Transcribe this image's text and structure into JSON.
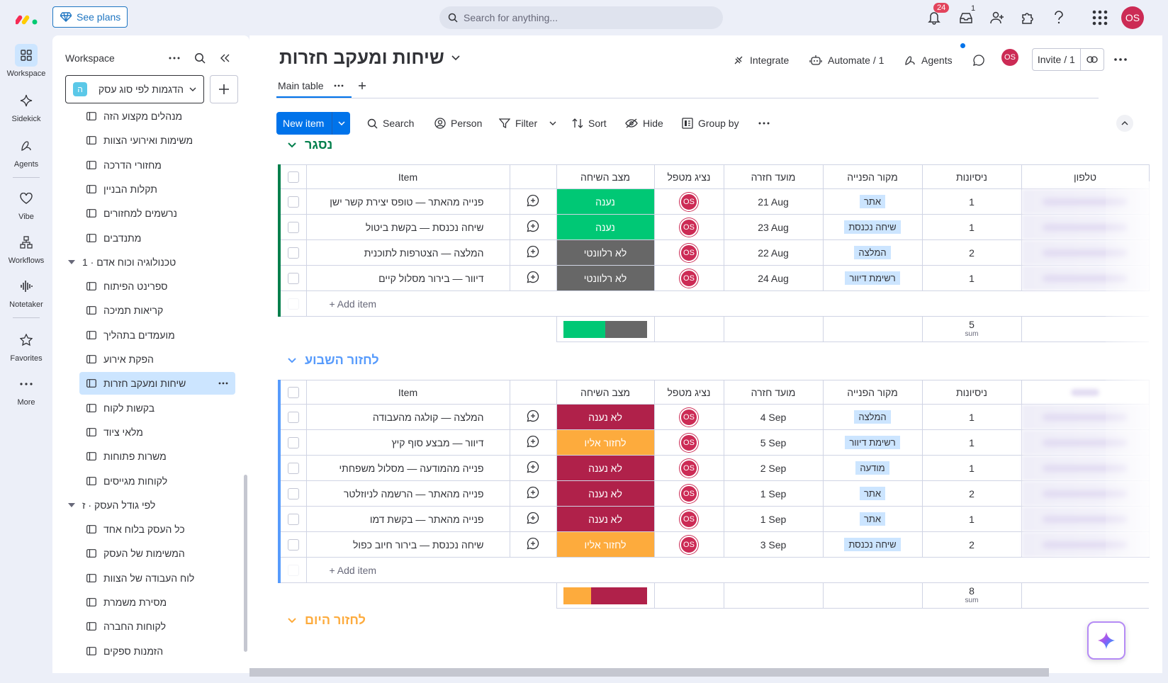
{
  "topbar": {
    "see_plans_label": "See plans",
    "search_placeholder": "Search for anything...",
    "notifications_count": "24",
    "inbox_count": "1",
    "avatar_initials": "OS"
  },
  "rail": {
    "items": [
      {
        "label": "Workspace",
        "icon": "grid-icon"
      },
      {
        "label": "Sidekick",
        "icon": "sparkle-icon"
      },
      {
        "label": "Agents",
        "icon": "agent-icon"
      },
      {
        "label": "Vibe",
        "icon": "heart-icon"
      },
      {
        "label": "Workflows",
        "icon": "workflow-icon"
      },
      {
        "label": "Notetaker",
        "icon": "waveform-icon"
      },
      {
        "label": "Favorites",
        "icon": "star-icon"
      },
      {
        "label": "More",
        "icon": "more-icon"
      }
    ]
  },
  "workspace": {
    "title": "Workspace",
    "selected_workspace": "הדגמות לפי סוג עסק",
    "workspace_letter": "ה",
    "tree": [
      {
        "type": "board",
        "label": "מנהלים מקצוע הזה"
      },
      {
        "type": "board",
        "label": "משימות ואירועי הצוות"
      },
      {
        "type": "board",
        "label": "מחזורי הדרכה"
      },
      {
        "type": "board",
        "label": "תקלות הבניין"
      },
      {
        "type": "board",
        "label": "נרשמים למחזורים"
      },
      {
        "type": "board",
        "label": "מתנדבים"
      },
      {
        "type": "folder",
        "label": "טכנולוגיה וכוח אדם · 1"
      },
      {
        "type": "board",
        "label": "ספרינט הפיתוח"
      },
      {
        "type": "board",
        "label": "קריאות תמיכה"
      },
      {
        "type": "board",
        "label": "מועמדים בתהליך"
      },
      {
        "type": "board",
        "label": "הפקת אירוע"
      },
      {
        "type": "board",
        "label": "שיחות ומעקב חזרות",
        "selected": true
      },
      {
        "type": "board",
        "label": "בקשות לקוח"
      },
      {
        "type": "board",
        "label": "מלאי ציוד"
      },
      {
        "type": "board",
        "label": "משרות פתוחות"
      },
      {
        "type": "board",
        "label": "לקוחות מגייסים"
      },
      {
        "type": "folder",
        "label": "לפי גודל העסק · ז"
      },
      {
        "type": "board",
        "label": "כל העסק בלוח אחד"
      },
      {
        "type": "board",
        "label": "המשימות של העסק"
      },
      {
        "type": "board",
        "label": "לוח העבודה של הצוות"
      },
      {
        "type": "board",
        "label": "מסירת משמרת"
      },
      {
        "type": "board",
        "label": "לקוחות החברה"
      },
      {
        "type": "board",
        "label": "הזמנות ספקים"
      }
    ]
  },
  "board": {
    "title": "שיחות ומעקב חזרות",
    "integrate_label": "Integrate",
    "automate_label": "Automate / 1",
    "agents_label": "Agents",
    "avatar_initials": "OS",
    "invite_label": "Invite / 1",
    "tab_label": "Main table",
    "new_item_label": "New item",
    "toolbar": {
      "search": "Search",
      "person": "Person",
      "filter": "Filter",
      "sort": "Sort",
      "hide": "Hide",
      "group_by": "Group by"
    },
    "columns": {
      "item": "Item",
      "status": "מצב השיחה",
      "owner": "נציג מטפל",
      "date": "מועד חזרה",
      "source": "מקור הפנייה",
      "attempts": "ניסיונות",
      "phone": "טלפון"
    },
    "add_item_label": "+ Add item",
    "sum_label": "sum",
    "status_colors": {
      "נענה": "#00c875",
      "לא רלוונטי": "#676767",
      "לא נענה": "#b0214a",
      "לחזור אליו": "#fdab3d"
    },
    "groups": [
      {
        "name": "נסגר",
        "color": "#037f4c",
        "sum": "5",
        "status_summary": [
          {
            "color": "#00c875",
            "fraction": 0.5
          },
          {
            "color": "#676767",
            "fraction": 0.5
          }
        ],
        "rows": [
          {
            "item": "פנייה מהאתר — טופס יצירת קשר ישן",
            "status": "נענה",
            "owner": "OS",
            "date": "21 Aug",
            "source": "אתר",
            "attempts": "1"
          },
          {
            "item": "שיחה נכנסת — בקשת ביטול",
            "status": "נענה",
            "owner": "OS",
            "date": "23 Aug",
            "source": "שיחה נכנסת",
            "attempts": "1"
          },
          {
            "item": "המלצה — הצטרפות לתוכנית",
            "status": "לא רלוונטי",
            "owner": "OS",
            "date": "22 Aug",
            "source": "המלצה",
            "attempts": "2"
          },
          {
            "item": "דיוור — בירור מסלול קיים",
            "status": "לא רלוונטי",
            "owner": "OS",
            "date": "24 Aug",
            "source": "רשימת דיוור",
            "attempts": "1"
          }
        ]
      },
      {
        "name": "לחזור השבוע",
        "color": "#579bfc",
        "sum": "8",
        "status_summary": [
          {
            "color": "#fdab3d",
            "fraction": 0.33
          },
          {
            "color": "#b0214a",
            "fraction": 0.67
          }
        ],
        "rows": [
          {
            "item": "המלצה — קולגה מהעבודה",
            "status": "לא נענה",
            "owner": "OS",
            "date": "4 Sep",
            "source": "המלצה",
            "attempts": "1"
          },
          {
            "item": "דיוור — מבצע סוף קיץ",
            "status": "לחזור אליו",
            "owner": "OS",
            "date": "5 Sep",
            "source": "רשימת דיוור",
            "attempts": "1"
          },
          {
            "item": "פנייה מהמודעה — מסלול משפחתי",
            "status": "לא נענה",
            "owner": "OS",
            "date": "2 Sep",
            "source": "מודעה",
            "attempts": "1"
          },
          {
            "item": "פנייה מהאתר — הרשמה לניוזלטר",
            "status": "לא נענה",
            "owner": "OS",
            "date": "1 Sep",
            "source": "אתר",
            "attempts": "2"
          },
          {
            "item": "פנייה מהאתר — בקשת דמו",
            "status": "לא נענה",
            "owner": "OS",
            "date": "1 Sep",
            "source": "אתר",
            "attempts": "1"
          },
          {
            "item": "שיחה נכנסת — בירור חיוב כפול",
            "status": "לחזור אליו",
            "owner": "OS",
            "date": "3 Sep",
            "source": "שיחה נכנסת",
            "attempts": "2"
          }
        ]
      },
      {
        "name": "לחזור היום",
        "color": "#fdab3d"
      }
    ]
  }
}
